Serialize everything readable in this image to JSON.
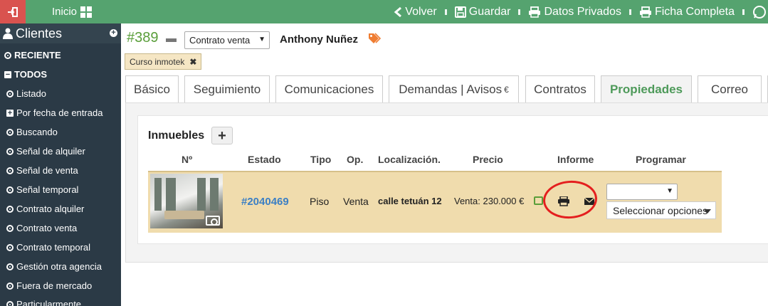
{
  "topbar": {
    "home_label": "Inicio",
    "actions": {
      "back": "Volver",
      "save": "Guardar",
      "private": "Datos Privados",
      "full_sheet": "Ficha Completa"
    },
    "colors": {
      "bar": "#55a36f",
      "exit": "#d9534f"
    }
  },
  "sidebar": {
    "title": "Clientes",
    "items": [
      "RECIENTE",
      "TODOS",
      "Listado",
      "Por fecha de entrada",
      "Buscando",
      "Señal de alquiler",
      "Señal de venta",
      "Señal temporal",
      "Contrato alquiler",
      "Contrato venta",
      "Contrato temporal",
      "Gestión otra agencia",
      "Fuera de mercado",
      "Particularmente"
    ]
  },
  "record": {
    "ref": "#389",
    "contract_type": "Contrato venta",
    "client_name": "Anthony Nuñez",
    "tag": "Curso inmotek"
  },
  "tabs": [
    "Básico",
    "Seguimiento",
    "Comunicaciones",
    "Demandas | Avisos",
    "Contratos",
    "Propiedades",
    "Correo"
  ],
  "tab_euro": "€",
  "active_tab": "Propiedades",
  "properties": {
    "title": "Inmuebles",
    "add_label": "+",
    "headers": {
      "num": "Nº",
      "status": "Estado",
      "type": "Tipo",
      "op": "Op.",
      "location": "Localización.",
      "price": "Precio",
      "report": "Informe",
      "schedule": "Programar"
    },
    "rows": [
      {
        "id": "#2040469",
        "type": "Piso",
        "op": "Venta",
        "location": "calle tetuán 12",
        "price": "Venta: 230.000 €",
        "schedule_placeholder": "Seleccionar opciones"
      }
    ]
  }
}
